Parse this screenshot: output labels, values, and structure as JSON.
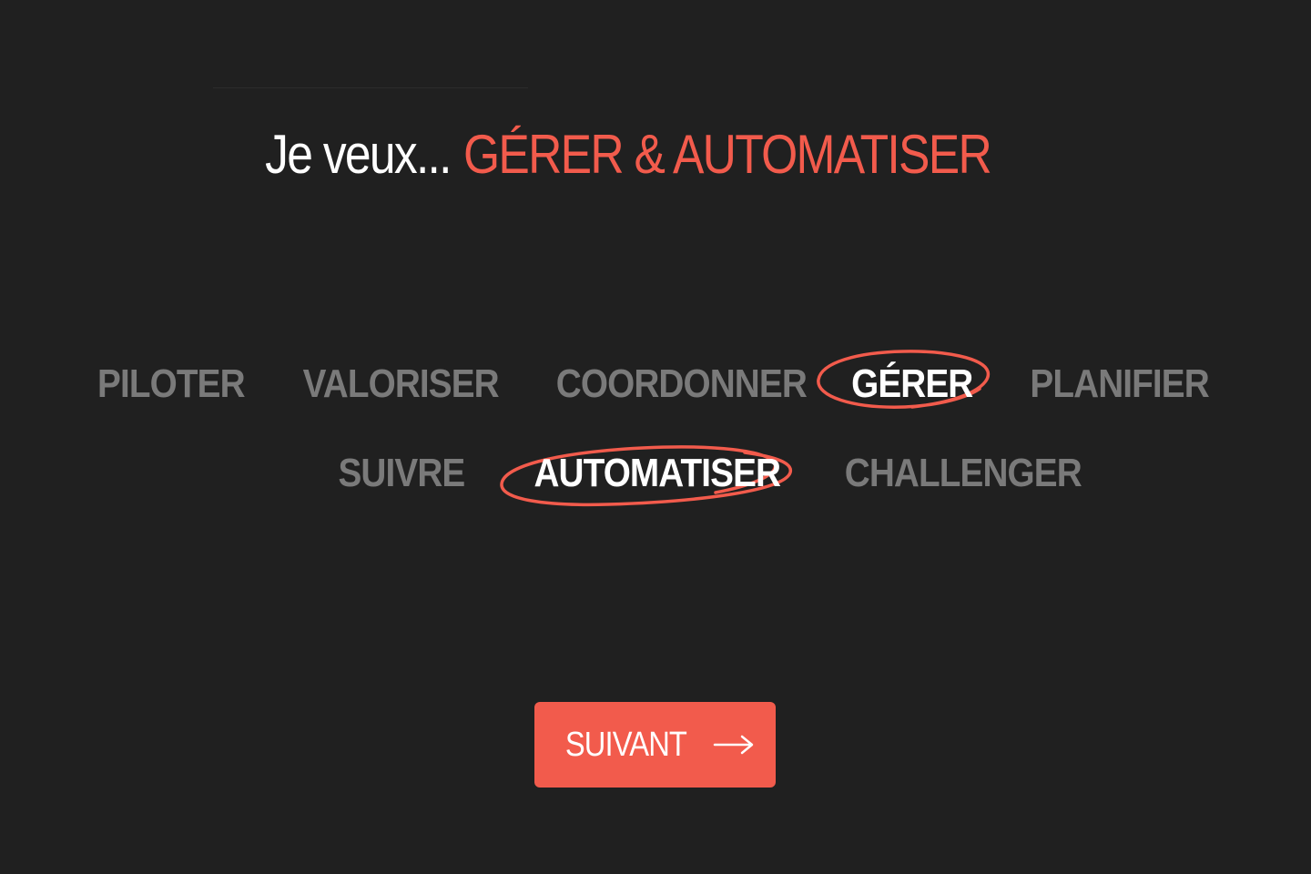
{
  "header": {
    "prefix": "Je veux...",
    "answer": "GÉRER & AUTOMATISER"
  },
  "options": [
    {
      "id": "piloter",
      "label": "PILOTER",
      "selected": false
    },
    {
      "id": "valoriser",
      "label": "VALORISER",
      "selected": false
    },
    {
      "id": "coordonner",
      "label": "COORDONNER",
      "selected": false
    },
    {
      "id": "gerer",
      "label": "GÉRER",
      "selected": true
    },
    {
      "id": "planifier",
      "label": "PLANIFIER",
      "selected": false
    },
    {
      "id": "suivre",
      "label": "SUIVRE",
      "selected": false
    },
    {
      "id": "automatiser",
      "label": "AUTOMATISER",
      "selected": true
    },
    {
      "id": "challenger",
      "label": "CHALLENGER",
      "selected": false
    }
  ],
  "next_button": {
    "label": "SUIVANT",
    "icon": "arrow-right-icon"
  },
  "colors": {
    "background": "#202020",
    "accent": "#f25b4c",
    "selected_text": "#ffffff",
    "unselected_text": "#7a7a7a"
  }
}
